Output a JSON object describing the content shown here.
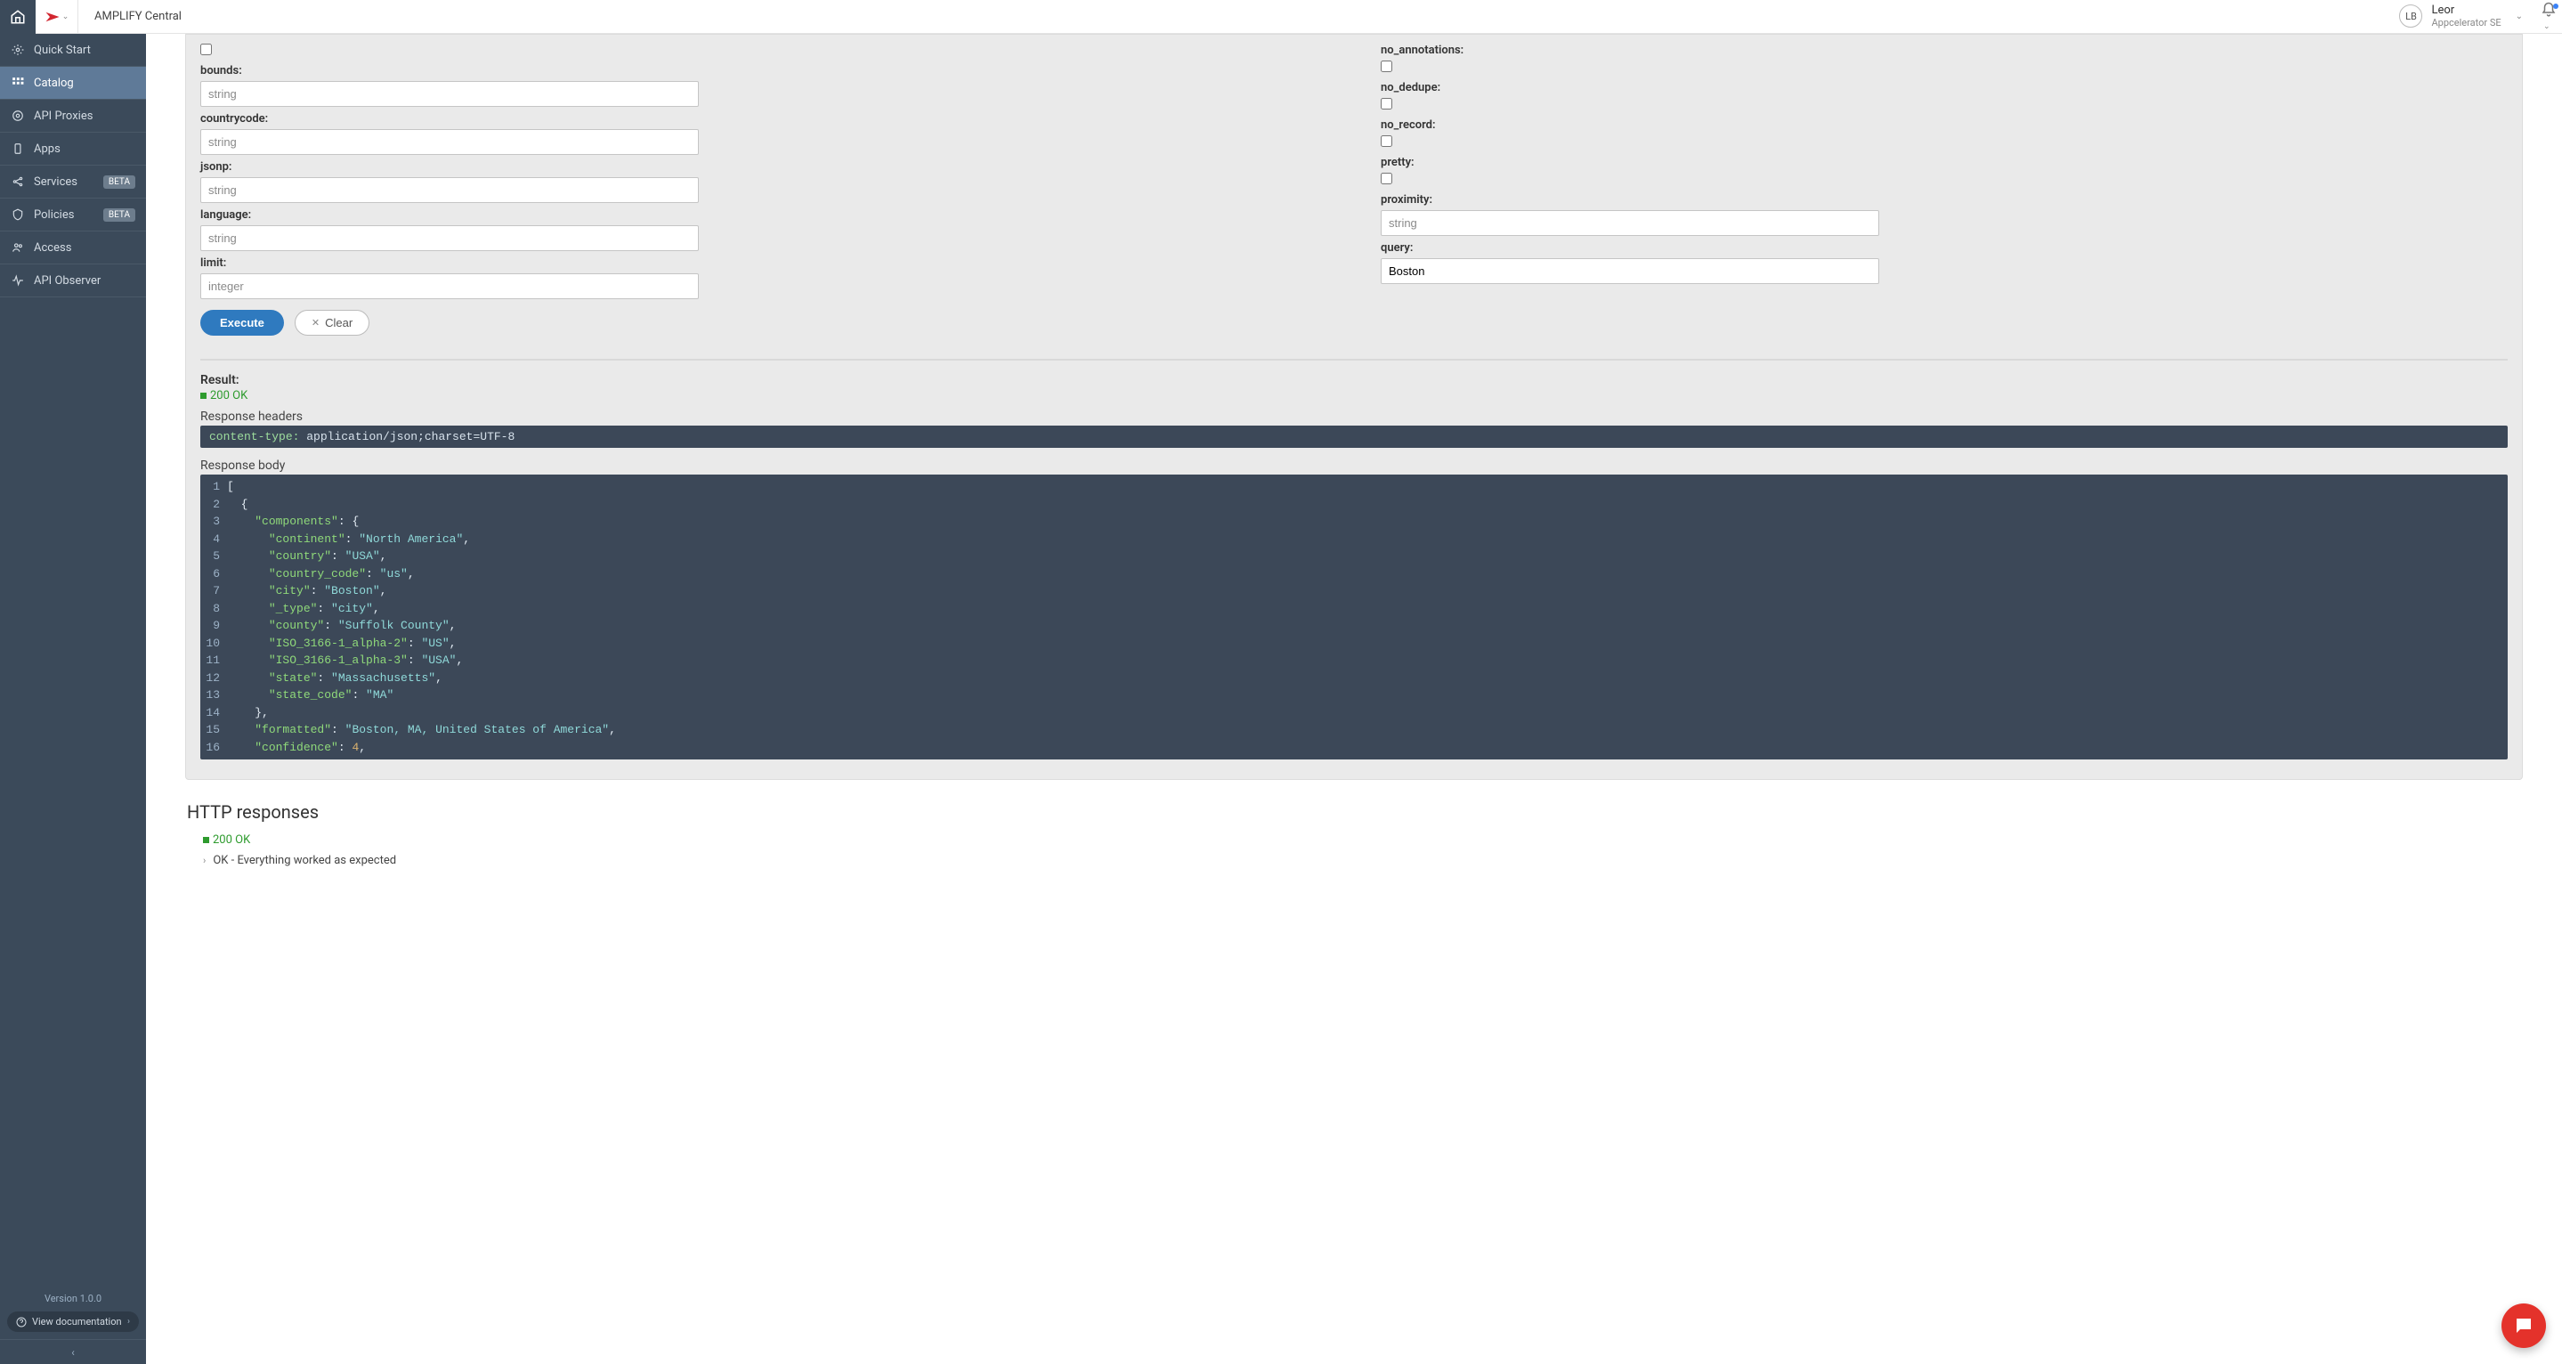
{
  "topbar": {
    "app_title": "AMPLIFY Central",
    "user_initials": "LB",
    "user_name": "Leor",
    "user_role": "Appcelerator SE"
  },
  "sidebar": {
    "version": "Version 1.0.0",
    "docs_label": "View documentation",
    "items": [
      {
        "label": "Quick Start"
      },
      {
        "label": "Catalog"
      },
      {
        "label": "API Proxies"
      },
      {
        "label": "Apps"
      },
      {
        "label": "Services",
        "badge": "BETA"
      },
      {
        "label": "Policies",
        "badge": "BETA"
      },
      {
        "label": "Access"
      },
      {
        "label": "API Observer"
      }
    ]
  },
  "params": {
    "left": [
      {
        "label": "bounds:",
        "type": "check"
      },
      {
        "label": "countrycode:",
        "type": "text",
        "placeholder": "string"
      },
      {
        "label": "jsonp:",
        "type": "text",
        "placeholder": "string"
      },
      {
        "label": "language:",
        "type": "text",
        "placeholder": "string"
      },
      {
        "label": "limit:",
        "type": "text",
        "placeholder": "integer"
      }
    ],
    "left_first": {
      "label": "bounds:",
      "placeholder": "string",
      "checkbox_visible": true
    },
    "right": [
      {
        "label": "no_annotations:",
        "type": "check"
      },
      {
        "label": "no_dedupe:",
        "type": "check"
      },
      {
        "label": "no_record:",
        "type": "check"
      },
      {
        "label": "pretty:",
        "type": "check"
      },
      {
        "label": "proximity:",
        "type": "text",
        "placeholder": "string"
      },
      {
        "label": "query:",
        "type": "text",
        "value": "Boston"
      }
    ]
  },
  "actions": {
    "execute": "Execute",
    "clear": "Clear"
  },
  "result": {
    "title": "Result:",
    "status": "200 OK",
    "headers_label": "Response headers",
    "header_key": "content-type:",
    "header_val": "application/json;charset=UTF-8",
    "body_label": "Response body",
    "body_lines": [
      {
        "n": 1,
        "indent": 0,
        "text": "["
      },
      {
        "n": 2,
        "indent": 1,
        "text": "{"
      },
      {
        "n": 3,
        "indent": 2,
        "key": "\"components\"",
        "after": ": {"
      },
      {
        "n": 4,
        "indent": 3,
        "key": "\"continent\"",
        "val": "\"North America\"",
        "comma": true
      },
      {
        "n": 5,
        "indent": 3,
        "key": "\"country\"",
        "val": "\"USA\"",
        "comma": true
      },
      {
        "n": 6,
        "indent": 3,
        "key": "\"country_code\"",
        "val": "\"us\"",
        "comma": true
      },
      {
        "n": 7,
        "indent": 3,
        "key": "\"city\"",
        "val": "\"Boston\"",
        "comma": true
      },
      {
        "n": 8,
        "indent": 3,
        "key": "\"_type\"",
        "val": "\"city\"",
        "comma": true
      },
      {
        "n": 9,
        "indent": 3,
        "key": "\"county\"",
        "val": "\"Suffolk County\"",
        "comma": true
      },
      {
        "n": 10,
        "indent": 3,
        "key": "\"ISO_3166-1_alpha-2\"",
        "val": "\"US\"",
        "comma": true
      },
      {
        "n": 11,
        "indent": 3,
        "key": "\"ISO_3166-1_alpha-3\"",
        "val": "\"USA\"",
        "comma": true
      },
      {
        "n": 12,
        "indent": 3,
        "key": "\"state\"",
        "val": "\"Massachusetts\"",
        "comma": true
      },
      {
        "n": 13,
        "indent": 3,
        "key": "\"state_code\"",
        "val": "\"MA\""
      },
      {
        "n": 14,
        "indent": 2,
        "text": "},"
      },
      {
        "n": 15,
        "indent": 2,
        "key": "\"formatted\"",
        "val": "\"Boston, MA, United States of America\"",
        "comma": true
      },
      {
        "n": 16,
        "indent": 2,
        "key": "\"confidence\"",
        "num": "4",
        "comma": true
      }
    ]
  },
  "http_responses": {
    "title": "HTTP responses",
    "status": "200 OK",
    "ok_line": "OK - Everything worked as expected"
  }
}
